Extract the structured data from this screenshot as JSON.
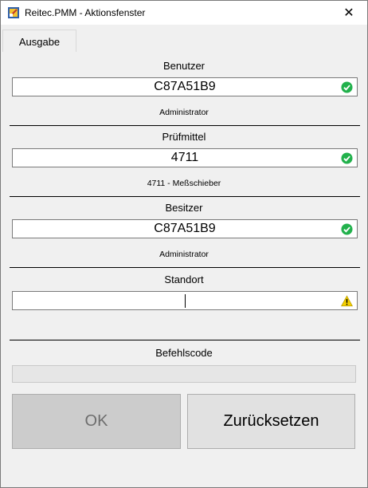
{
  "window": {
    "title": "Reitec.PMM - Aktionsfenster",
    "close_glyph": "✕"
  },
  "tabs": [
    {
      "label": "Ausgabe",
      "selected": true
    }
  ],
  "fields": {
    "benutzer": {
      "label": "Benutzer",
      "value": "C87A51B9",
      "subtext": "Administrator",
      "status": "ok",
      "status_icon": "check-circle-icon"
    },
    "pruefmittel": {
      "label": "Prüfmittel",
      "value": "4711",
      "subtext": "4711 - Meßschieber",
      "status": "ok",
      "status_icon": "check-circle-icon"
    },
    "besitzer": {
      "label": "Besitzer",
      "value": "C87A51B9",
      "subtext": "Administrator",
      "status": "ok",
      "status_icon": "check-circle-icon"
    },
    "standort": {
      "label": "Standort",
      "value": "",
      "status": "warning",
      "status_icon": "warning-triangle-icon"
    }
  },
  "befehlscode": {
    "label": "Befehlscode",
    "value": ""
  },
  "buttons": {
    "ok_label": "OK",
    "ok_enabled": false,
    "reset_label": "Zurücksetzen"
  },
  "colors": {
    "ok_green": "#22b14c",
    "warning_yellow": "#f5d000",
    "disabled_button": "#cccccc"
  }
}
